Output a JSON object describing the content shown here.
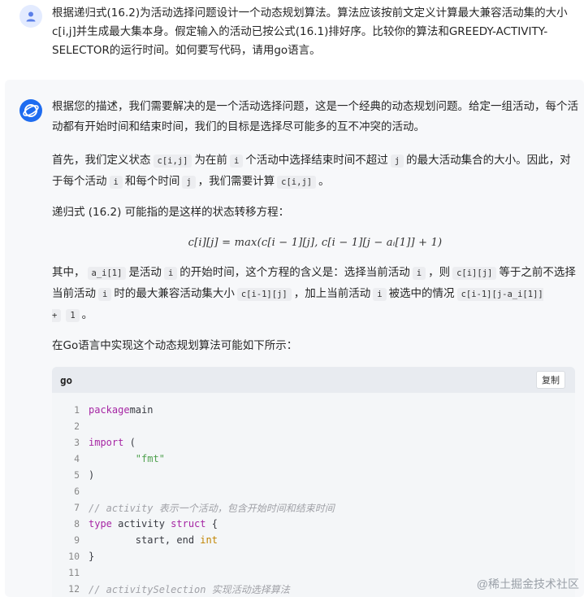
{
  "user_message": {
    "text": "根据递归式(16.2)为活动选择问题设计一个动态规划算法。算法应该按前文定义计算最大兼容活动集的大小c[i,j]并生成最大集本身。假定输入的活动已按公式(16.1)排好序。比较你的算法和GREEDY-ACTIVITY-SELECTOR的运行时间。如何要写代码，请用go语言。"
  },
  "ai_message": {
    "p1": "根据您的描述，我们需要解决的是一个活动选择问题，这是一个经典的动态规划问题。给定一组活动，每个活动都有开始时间和结束时间，我们的目标是选择尽可能多的互不冲突的活动。",
    "p2": {
      "t1": "首先，我们定义状态",
      "c1": "c[i,j]",
      "t2": "为在前",
      "c2": "i",
      "t3": "个活动中选择结束时间不超过",
      "c3": "j",
      "t4": "的最大活动集合的大小。因此，对于每个活动",
      "c4": "i",
      "t5": "和每个时间",
      "c5": "j",
      "t6": "，我们需要计算",
      "c6": "c[i,j]",
      "t7": "。"
    },
    "p3": "递归式 (16.2) 可能指的是这样的状态转移方程：",
    "formula": "c[i][j] = max(c[i − 1][j], c[i − 1][j − aᵢ[1]] + 1)",
    "p4": {
      "t1": "其中，",
      "c1": "a_i[1]",
      "t2": "是活动",
      "c2": "i",
      "t3": "的开始时间，这个方程的含义是：选择当前活动",
      "c3": "i",
      "t4": "，则",
      "c4": "c[i][j]",
      "t5": "等于之前不选择当前活动",
      "c5": "i",
      "t6": "时的最大兼容活动集大小",
      "c6": "c[i-1][j]",
      "t7": "，加上当前活动",
      "c7": "i",
      "t8": "被选中的情况",
      "c8": "c[i-1][j-a_i[1]] +",
      "c9": "1",
      "t9": "。"
    },
    "p5": "在Go语言中实现这个动态规划算法可能如下所示："
  },
  "code_block": {
    "language": "go",
    "copy_label": "复制",
    "lines": [
      {
        "n": "1",
        "parts": [
          [
            "kw",
            "package"
          ],
          [
            "",
            "main"
          ]
        ]
      },
      {
        "n": "2",
        "parts": []
      },
      {
        "n": "3",
        "parts": [
          [
            "kw",
            "import"
          ],
          [
            "",
            " ("
          ]
        ]
      },
      {
        "n": "4",
        "parts": [
          [
            "",
            "        "
          ],
          [
            "str",
            "\"fmt\""
          ]
        ]
      },
      {
        "n": "5",
        "parts": [
          [
            "",
            ")"
          ]
        ]
      },
      {
        "n": "6",
        "parts": []
      },
      {
        "n": "7",
        "parts": [
          [
            "cm",
            "// activity 表示一个活动，包含开始时间和结束时间"
          ]
        ]
      },
      {
        "n": "8",
        "parts": [
          [
            "kw",
            "type"
          ],
          [
            "",
            " activity "
          ],
          [
            "kw",
            "struct"
          ],
          [
            "",
            " {"
          ]
        ]
      },
      {
        "n": "9",
        "parts": [
          [
            "",
            "        start, end "
          ],
          [
            "ty",
            "int"
          ]
        ]
      },
      {
        "n": "10",
        "parts": [
          [
            "",
            "}"
          ]
        ]
      },
      {
        "n": "11",
        "parts": []
      },
      {
        "n": "12",
        "parts": [
          [
            "cm",
            "// activitySelection 实现活动选择算法"
          ]
        ]
      }
    ]
  },
  "watermark": "@稀土掘金技术社区",
  "colors": {
    "ai_avatar": "#1e6cf0",
    "user_avatar_bg": "#e3ebff",
    "keyword": "#a626a4",
    "string": "#50a14f",
    "comment": "#a0a1a7"
  },
  "icons": {
    "user_avatar": "person-icon",
    "ai_avatar": "planet-logo-icon"
  }
}
